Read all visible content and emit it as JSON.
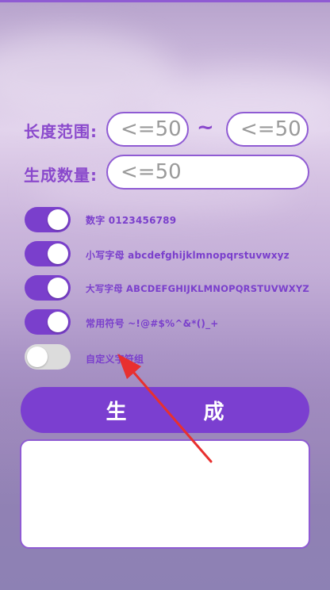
{
  "length_range": {
    "label": "长度范围:",
    "min_placeholder": "<=50",
    "separator": "~",
    "max_placeholder": "<=50"
  },
  "count": {
    "label": "生成数量:",
    "placeholder": "<=50"
  },
  "options": [
    {
      "label": "数字 0123456789",
      "enabled": true
    },
    {
      "label": "小写字母 abcdefghijklmnopqrstuvwxyz",
      "enabled": true
    },
    {
      "label": "大写字母 ABCDEFGHIJKLMNOPQRSTUVWXYZ",
      "enabled": true
    },
    {
      "label": "常用符号 ~!@#$%^&*()_+",
      "enabled": true
    },
    {
      "label": "自定义字符组",
      "enabled": false
    }
  ],
  "generate_button": "生 成",
  "colors": {
    "accent": "#7b3fd0",
    "toggle_off": "#dcdcdc",
    "arrow": "#e8302f"
  }
}
